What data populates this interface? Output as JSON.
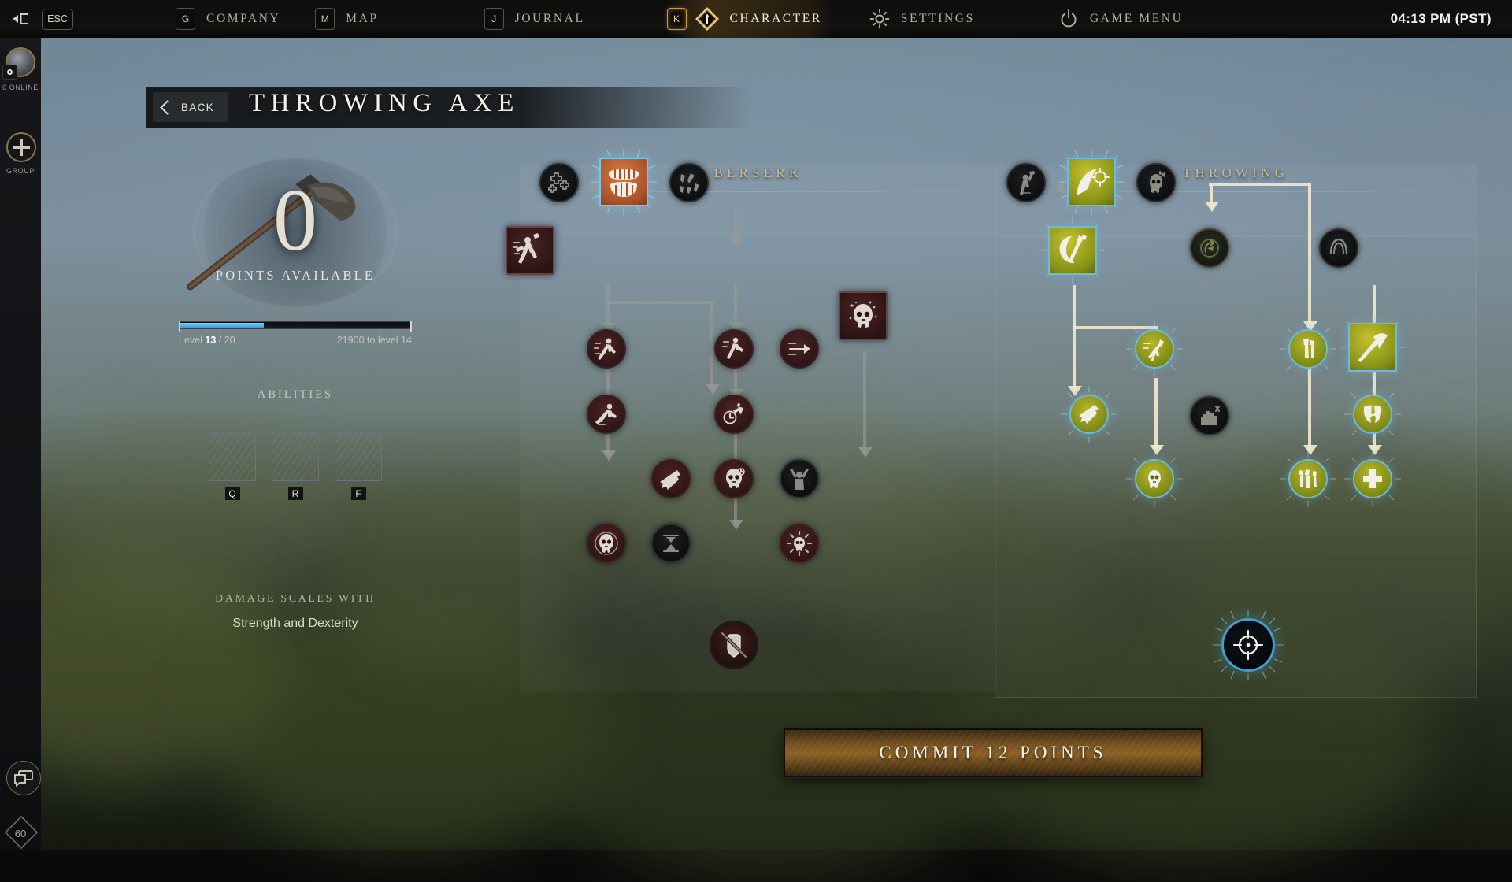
{
  "topbar": {
    "esc_label": "ESC",
    "back_icon": "back-arrow-icon",
    "items": [
      {
        "key": "G",
        "label": "COMPANY",
        "icon": "",
        "active": false
      },
      {
        "key": "M",
        "label": "MAP",
        "icon": "",
        "active": false
      },
      {
        "key": "J",
        "label": "JOURNAL",
        "icon": "",
        "active": false
      },
      {
        "key": "K",
        "label": "CHARACTER",
        "icon": "diamond-icon",
        "active": true
      },
      {
        "key": "",
        "label": "SETTINGS",
        "icon": "gear-icon",
        "active": false
      },
      {
        "key": "",
        "label": "GAME MENU",
        "icon": "power-icon",
        "active": false
      }
    ],
    "clock": "04:13 PM  (PST)"
  },
  "sidebar": {
    "avatar_icon": "avatar",
    "online_label": "0 ONLINE",
    "group_label": "GROUP",
    "group_icon": "plus-icon",
    "chat_icon": "chat-bubble-icon",
    "fps": "60"
  },
  "header": {
    "back_label": "BACK",
    "title": "THROWING AXE"
  },
  "left_panel": {
    "points_available": "0",
    "points_label": "POINTS AVAILABLE",
    "level_prefix": "Level",
    "level_current": "13",
    "level_sep": "/ 20",
    "xp_to_next": "21900 to level 14",
    "xp_percent": 36,
    "abilities_label": "ABILITIES",
    "abilities": [
      {
        "name": "ability-slot-q",
        "key": "Q",
        "filled": false
      },
      {
        "name": "ability-slot-r",
        "key": "R",
        "filled": false
      },
      {
        "name": "ability-slot-f",
        "key": "F",
        "filled": false
      }
    ],
    "damage_label": "DAMAGE SCALES WITH",
    "damage_value": "Strength and Dexterity"
  },
  "trees": [
    {
      "id": "berserk",
      "title": "BERSERK"
    },
    {
      "id": "throwing",
      "title": "THROWING"
    }
  ],
  "berserk_nodes": [
    {
      "name": "node-berserk-rage-plus",
      "icon": "cross-cluster-icon",
      "state": "locked",
      "shape": "circle"
    },
    {
      "name": "node-berserk-activate",
      "icon": "roaring-mouth-icon",
      "state": "orange",
      "shape": "square"
    },
    {
      "name": "node-berserk-fury-shards",
      "icon": "shards-icon",
      "state": "locked",
      "shape": "circle"
    },
    {
      "name": "node-berserk-throw-attack",
      "icon": "axe-thrower-icon",
      "state": "red",
      "shape": "square"
    },
    {
      "name": "node-berserk-sprint",
      "icon": "running-figure-icon",
      "state": "red",
      "shape": "circle"
    },
    {
      "name": "node-berserk-charge",
      "icon": "arrow-dash-icon",
      "state": "red",
      "shape": "circle"
    },
    {
      "name": "node-berserk-lunge",
      "icon": "leaping-figure-icon",
      "state": "red",
      "shape": "circle"
    },
    {
      "name": "node-berserk-cooldown",
      "icon": "clock-arrow-icon",
      "state": "red",
      "shape": "circle"
    },
    {
      "name": "node-berserk-bleed",
      "icon": "feather-strike-icon",
      "state": "red",
      "shape": "circle"
    },
    {
      "name": "node-berserk-skull-timer",
      "icon": "skull-clock-icon",
      "state": "red",
      "shape": "circle"
    },
    {
      "name": "node-berserk-raised-arms",
      "icon": "raised-arms-icon",
      "state": "locked",
      "shape": "circle"
    },
    {
      "name": "node-berserk-blood-skull",
      "icon": "bleeding-skull-icon",
      "state": "red",
      "shape": "square"
    },
    {
      "name": "node-berserk-execute",
      "icon": "skull-target-icon",
      "state": "red",
      "shape": "circle"
    },
    {
      "name": "node-berserk-hourglass",
      "icon": "hourglass-icon",
      "state": "locked",
      "shape": "circle"
    },
    {
      "name": "node-berserk-burst",
      "icon": "burst-skull-icon",
      "state": "red",
      "shape": "circle"
    },
    {
      "name": "node-berserk-ultimate",
      "icon": "no-shield-icon",
      "state": "ultred",
      "shape": "circle"
    }
  ],
  "throwing_nodes": [
    {
      "name": "node-throwing-thrower",
      "icon": "axe-thrower-icon",
      "state": "locked",
      "shape": "circle"
    },
    {
      "name": "node-throwing-axe-throw",
      "icon": "arc-crosshair-icon",
      "state": "olive",
      "shape": "square"
    },
    {
      "name": "node-throwing-skull-mark",
      "icon": "skull-mark-icon",
      "state": "locked",
      "shape": "circle"
    },
    {
      "name": "node-throwing-double-axe",
      "icon": "twin-axes-icon",
      "state": "olive",
      "shape": "square"
    },
    {
      "name": "node-throwing-recall",
      "icon": "return-spiral-icon",
      "state": "darkolive",
      "shape": "circle"
    },
    {
      "name": "node-throwing-headgear",
      "icon": "helm-icon",
      "state": "locked",
      "shape": "circle"
    },
    {
      "name": "node-throwing-strike-dash",
      "icon": "dash-strike-icon",
      "state": "olive",
      "shape": "circle"
    },
    {
      "name": "node-throwing-axe-upgrade",
      "icon": "single-axe-icon",
      "state": "olive",
      "shape": "circle"
    },
    {
      "name": "node-throwing-mighty-throw",
      "icon": "big-axe-icon",
      "state": "olive",
      "shape": "square"
    },
    {
      "name": "node-throwing-feather",
      "icon": "feather-strike-icon",
      "state": "olive",
      "shape": "circle"
    },
    {
      "name": "node-throwing-grip",
      "icon": "grip-hands-icon",
      "state": "locked",
      "shape": "circle"
    },
    {
      "name": "node-throwing-shield-break",
      "icon": "broken-shield-icon",
      "state": "olive",
      "shape": "circle"
    },
    {
      "name": "node-throwing-execute",
      "icon": "skull-target-icon",
      "state": "olive",
      "shape": "circle"
    },
    {
      "name": "node-throwing-triple-axe",
      "icon": "three-axes-icon",
      "state": "olive",
      "shape": "circle"
    },
    {
      "name": "node-throwing-heal",
      "icon": "plus-cross-icon",
      "state": "olive",
      "shape": "circle"
    },
    {
      "name": "node-throwing-ultimate",
      "icon": "crosshair-icon",
      "state": "ult",
      "shape": "circle"
    }
  ],
  "commit": {
    "label": "COMMIT 12 POINTS"
  },
  "colors": {
    "accent_gold": "#c79a3e",
    "xp_blue": "#2f9fe0",
    "active_ring": "#6fb9dd",
    "olive": "#8a9418",
    "orange": "#a8522a",
    "maroon": "#4b2426",
    "commit_brown": "#8a6125"
  }
}
